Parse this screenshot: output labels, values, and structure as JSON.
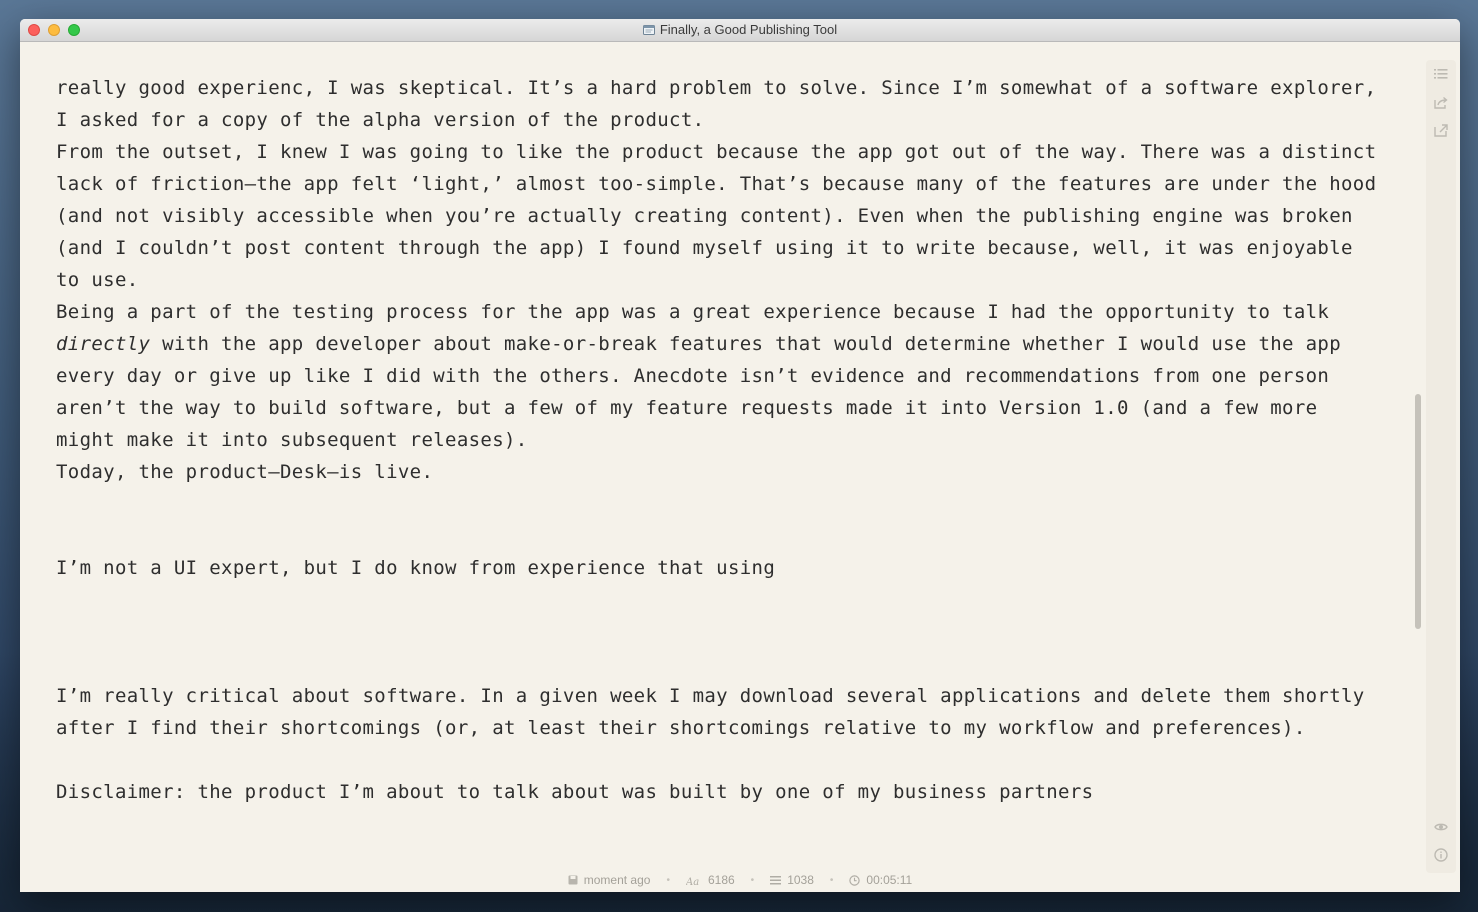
{
  "window": {
    "title": "Finally, a Good Publishing Tool"
  },
  "editor": {
    "paragraphs": [
      {
        "lines": [
          "really good experienc, I was skeptical. It’s a hard problem to solve. Since I’m somewhat of a software explorer,",
          "I asked for a copy of the alpha version of the product."
        ]
      },
      {
        "lines": [
          "From the outset, I knew I was going to like the product because the app got out of the way. There was a distinct",
          "lack of friction—the app felt ‘light,’ almost too-simple. That’s because many of the features are under the hood",
          "(and not visibly accessible when you’re actually creating content). Even when the publishing engine was broken",
          "(and I couldn’t post content through the app) I found myself using it to write because, well, it was enjoyable",
          "to use."
        ]
      },
      {
        "line1": "Being a part of the testing process for the app was a great experience because I had the opportunity to talk",
        "emphasis": "directly",
        "line2_rest": " with the app developer about make-or-break features that would determine whether I would use the app",
        "lines_after": [
          "every day or give up like I did with the others. Anecdote isn’t evidence and recommendations from one person",
          "aren’t the way to build software, but a few of my feature requests made it into Version 1.0 (and a few more",
          "might make it into subsequent releases)."
        ]
      },
      {
        "lines": [
          "Today, the product—Desk—is live."
        ]
      },
      {
        "lines": [
          "I’m not a UI expert, but I do know from experience that using"
        ]
      },
      {
        "lines": [
          "I’m really critical about software. In a given week I may download several applications and delete them shortly",
          "after I find their shortcomings (or, at least their shortcomings relative to my workflow and preferences)."
        ]
      },
      {
        "lines": [
          "Disclaimer: the product I’m about to talk about was built by one of my business partners"
        ]
      }
    ]
  },
  "sidebar": {
    "icons": [
      "list-icon",
      "share-icon",
      "publish-icon",
      "preview-eye-icon",
      "info-icon"
    ]
  },
  "status": {
    "saved": "moment ago",
    "characters": "6186",
    "words": "1038",
    "time": "00:05:11"
  },
  "colors": {
    "background": "#f5f2ea",
    "text": "#2e2e2e",
    "status_text": "#a4a199"
  }
}
